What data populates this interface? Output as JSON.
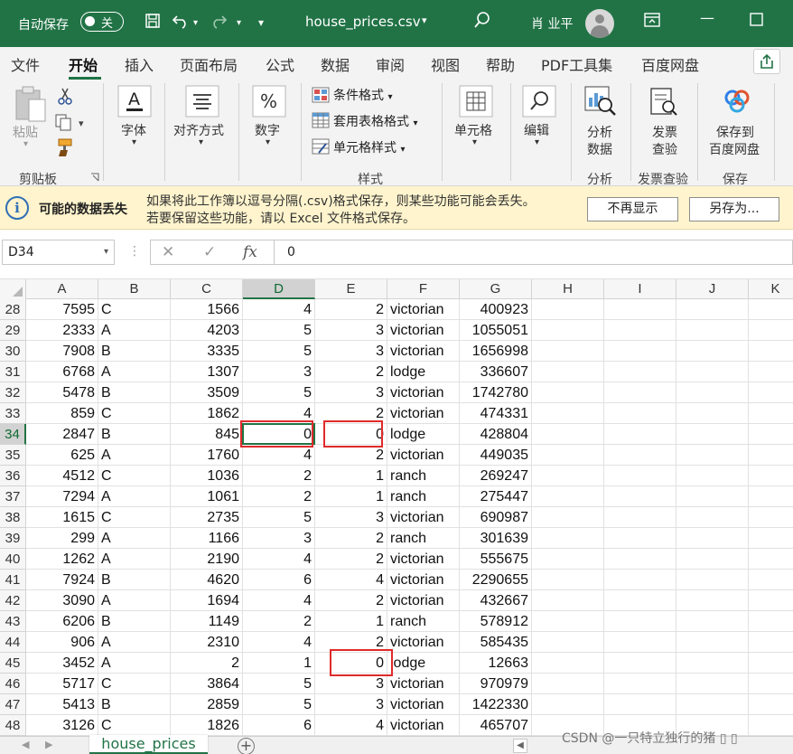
{
  "titlebar": {
    "autosave_label": "自动保存",
    "autosave_state": "关",
    "doc_title": "house_prices.csv",
    "user_name": "肖 业平",
    "accent_color": "#217346"
  },
  "menu": {
    "tabs": [
      "文件",
      "开始",
      "插入",
      "页面布局",
      "公式",
      "数据",
      "审阅",
      "视图",
      "帮助",
      "PDF工具集",
      "百度网盘"
    ],
    "active": "开始"
  },
  "ribbon": {
    "paste_label": "粘贴",
    "clipboard_group": "剪贴板",
    "font_label": "字体",
    "align_label": "对齐方式",
    "number_label": "数字",
    "cond_format": "条件格式",
    "table_format": "套用表格格式",
    "cell_style": "单元格样式",
    "styles_group": "样式",
    "cells_label": "单元格",
    "edit_label": "编辑",
    "analyze_label_1": "分析",
    "analyze_label_2": "数据",
    "analyze_group": "分析",
    "invoice_label_1": "发票",
    "invoice_label_2": "查验",
    "invoice_group": "发票查验",
    "save_label_1": "保存到",
    "save_label_2": "百度网盘",
    "save_group": "保存"
  },
  "infobar": {
    "title": "可能的数据丢失",
    "line1": "如果将此工作簿以逗号分隔(.csv)格式保存，则某些功能可能会丢失。",
    "line2": "若要保留这些功能，请以 Excel 文件格式保存。",
    "dont_show": "不再显示",
    "save_as": "另存为..."
  },
  "formula": {
    "name_box": "D34",
    "value": "0",
    "fx": "fx"
  },
  "columns": [
    "A",
    "B",
    "C",
    "D",
    "E",
    "F",
    "G",
    "H",
    "I",
    "J",
    "K"
  ],
  "selected_column": "D",
  "selected_row": "34",
  "rows": [
    {
      "n": "28",
      "a": "7595",
      "b": "C",
      "c": "1566",
      "d": "4",
      "e": "2",
      "f": "victorian",
      "g": "400923"
    },
    {
      "n": "29",
      "a": "2333",
      "b": "A",
      "c": "4203",
      "d": "5",
      "e": "3",
      "f": "victorian",
      "g": "1055051"
    },
    {
      "n": "30",
      "a": "7908",
      "b": "B",
      "c": "3335",
      "d": "5",
      "e": "3",
      "f": "victorian",
      "g": "1656998"
    },
    {
      "n": "31",
      "a": "6768",
      "b": "A",
      "c": "1307",
      "d": "3",
      "e": "2",
      "f": "lodge",
      "g": "336607"
    },
    {
      "n": "32",
      "a": "5478",
      "b": "B",
      "c": "3509",
      "d": "5",
      "e": "3",
      "f": "victorian",
      "g": "1742780"
    },
    {
      "n": "33",
      "a": "859",
      "b": "C",
      "c": "1862",
      "d": "4",
      "e": "2",
      "f": "victorian",
      "g": "474331"
    },
    {
      "n": "34",
      "a": "2847",
      "b": "B",
      "c": "845",
      "d": "0",
      "e": "0",
      "f": "lodge",
      "g": "428804"
    },
    {
      "n": "35",
      "a": "625",
      "b": "A",
      "c": "1760",
      "d": "4",
      "e": "2",
      "f": "victorian",
      "g": "449035"
    },
    {
      "n": "36",
      "a": "4512",
      "b": "C",
      "c": "1036",
      "d": "2",
      "e": "1",
      "f": "ranch",
      "g": "269247"
    },
    {
      "n": "37",
      "a": "7294",
      "b": "A",
      "c": "1061",
      "d": "2",
      "e": "1",
      "f": "ranch",
      "g": "275447"
    },
    {
      "n": "38",
      "a": "1615",
      "b": "C",
      "c": "2735",
      "d": "5",
      "e": "3",
      "f": "victorian",
      "g": "690987"
    },
    {
      "n": "39",
      "a": "299",
      "b": "A",
      "c": "1166",
      "d": "3",
      "e": "2",
      "f": "ranch",
      "g": "301639"
    },
    {
      "n": "40",
      "a": "1262",
      "b": "A",
      "c": "2190",
      "d": "4",
      "e": "2",
      "f": "victorian",
      "g": "555675"
    },
    {
      "n": "41",
      "a": "7924",
      "b": "B",
      "c": "4620",
      "d": "6",
      "e": "4",
      "f": "victorian",
      "g": "2290655"
    },
    {
      "n": "42",
      "a": "3090",
      "b": "A",
      "c": "1694",
      "d": "4",
      "e": "2",
      "f": "victorian",
      "g": "432667"
    },
    {
      "n": "43",
      "a": "6206",
      "b": "B",
      "c": "1149",
      "d": "2",
      "e": "1",
      "f": "ranch",
      "g": "578912"
    },
    {
      "n": "44",
      "a": "906",
      "b": "A",
      "c": "2310",
      "d": "4",
      "e": "2",
      "f": "victorian",
      "g": "585435"
    },
    {
      "n": "45",
      "a": "3452",
      "b": "A",
      "c": "2",
      "d": "1",
      "e": "0",
      "f": "lodge",
      "g": "12663"
    },
    {
      "n": "46",
      "a": "5717",
      "b": "C",
      "c": "3864",
      "d": "5",
      "e": "3",
      "f": "victorian",
      "g": "970979"
    },
    {
      "n": "47",
      "a": "5413",
      "b": "B",
      "c": "2859",
      "d": "5",
      "e": "3",
      "f": "victorian",
      "g": "1422330"
    },
    {
      "n": "48",
      "a": "3126",
      "b": "C",
      "c": "1826",
      "d": "6",
      "e": "4",
      "f": "victorian",
      "g": "465707"
    }
  ],
  "sheet": {
    "tab_name": "house_prices",
    "add_symbol": "+"
  },
  "watermark": "CSDN @一只特立独行的猪 ▯ ▯",
  "annotation_color": "#e02a2a"
}
